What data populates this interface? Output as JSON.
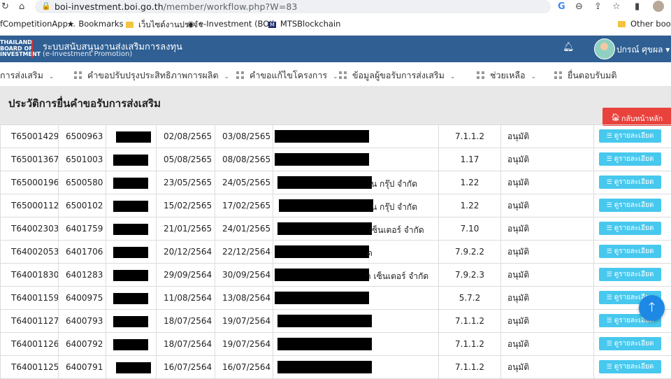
{
  "browser": {
    "url_host": "boi-investment.boi.go.th",
    "url_path": "/member/workflow.php?W=83",
    "bookmarks": [
      {
        "label": "fCompetitionApp..."
      },
      {
        "label": "Bookmarks"
      },
      {
        "label": "เว็บไซต์งานประจำ"
      },
      {
        "label": "e-Investment (BOI)"
      },
      {
        "label": "MTSBlockchain"
      },
      {
        "label": "Other bookm"
      }
    ]
  },
  "app": {
    "logo_line1": "THAILAND",
    "logo_line2": "BOARD OF",
    "logo_line3": "INVESTMENT",
    "title": "ระบบสนับสนุนงานส่งเสริมการลงทุน",
    "subtitle": "(e-Investment Promotion)",
    "username": "ปกรณ์ ศุขผล ▾"
  },
  "menu": [
    {
      "label": "การส่งเสริม"
    },
    {
      "label": "คำขอปรับปรุงประสิทธิภาพการผลิต"
    },
    {
      "label": "คำขอแก้ไขโครงการ"
    },
    {
      "label": "ข้อมูลผู้ขอรับการส่งเสริม"
    },
    {
      "label": "ช่วยเหลือ"
    },
    {
      "label": "ยื่นตอบรับมติ"
    }
  ],
  "page": {
    "title": "ประวัติการยื่นคำขอรับการส่งเสริม",
    "home_button": "กลับหน้าหลัก",
    "detail_button": "ดูรายละเอียด"
  },
  "rows": [
    {
      "id": "T65001429",
      "no": "6500963",
      "d1": "02/08/2565",
      "d2": "03/08/2565",
      "suffix": "",
      "type": "7.1.1.2",
      "status": "อนุมัติ"
    },
    {
      "id": "T65001367",
      "no": "6501003",
      "d1": "05/08/2565",
      "d2": "08/08/2565",
      "suffix": "",
      "type": "1.17",
      "status": "อนุมัติ"
    },
    {
      "id": "T65000196",
      "no": "6500580",
      "d1": "23/05/2565",
      "d2": "24/05/2565",
      "suffix": "น กรุ๊ป จำกัด",
      "type": "1.22",
      "status": "อนุมัติ"
    },
    {
      "id": "T65000112",
      "no": "6500102",
      "d1": "15/02/2565",
      "d2": "17/02/2565",
      "suffix": "น กรุ๊ป จำกัด",
      "type": "1.22",
      "status": "อนุมัติ"
    },
    {
      "id": "T64002303",
      "no": "6401759",
      "d1": "21/01/2565",
      "d2": "24/01/2565",
      "suffix": "เซ็นเตอร์ จำกัด",
      "type": "7.10",
      "status": "อนุมัติ"
    },
    {
      "id": "T64002053",
      "no": "6401706",
      "d1": "20/12/2564",
      "d2": "22/12/2564",
      "suffix": "ด",
      "type": "7.9.2.2",
      "status": "อนุมัติ"
    },
    {
      "id": "T64001830",
      "no": "6401283",
      "d1": "29/09/2564",
      "d2": "30/09/2564",
      "suffix": "า เซ็นเตอร์ จำกัด",
      "type": "7.9.2.3",
      "status": "อนุมัติ"
    },
    {
      "id": "T64001159",
      "no": "6400975",
      "d1": "11/08/2564",
      "d2": "13/08/2564",
      "suffix": "",
      "type": "5.7.2",
      "status": "อนุมัติ"
    },
    {
      "id": "T64001127",
      "no": "6400793",
      "d1": "18/07/2564",
      "d2": "19/07/2564",
      "suffix": "",
      "type": "7.1.1.2",
      "status": "อนุมัติ"
    },
    {
      "id": "T64001126",
      "no": "6400792",
      "d1": "18/07/2564",
      "d2": "19/07/2564",
      "suffix": "",
      "type": "7.1.1.2",
      "status": "อนุมัติ"
    },
    {
      "id": "T64001125",
      "no": "6400791",
      "d1": "16/07/2564",
      "d2": "16/07/2564",
      "suffix": "",
      "type": "7.1.1.2",
      "status": "อนุมัติ"
    }
  ]
}
